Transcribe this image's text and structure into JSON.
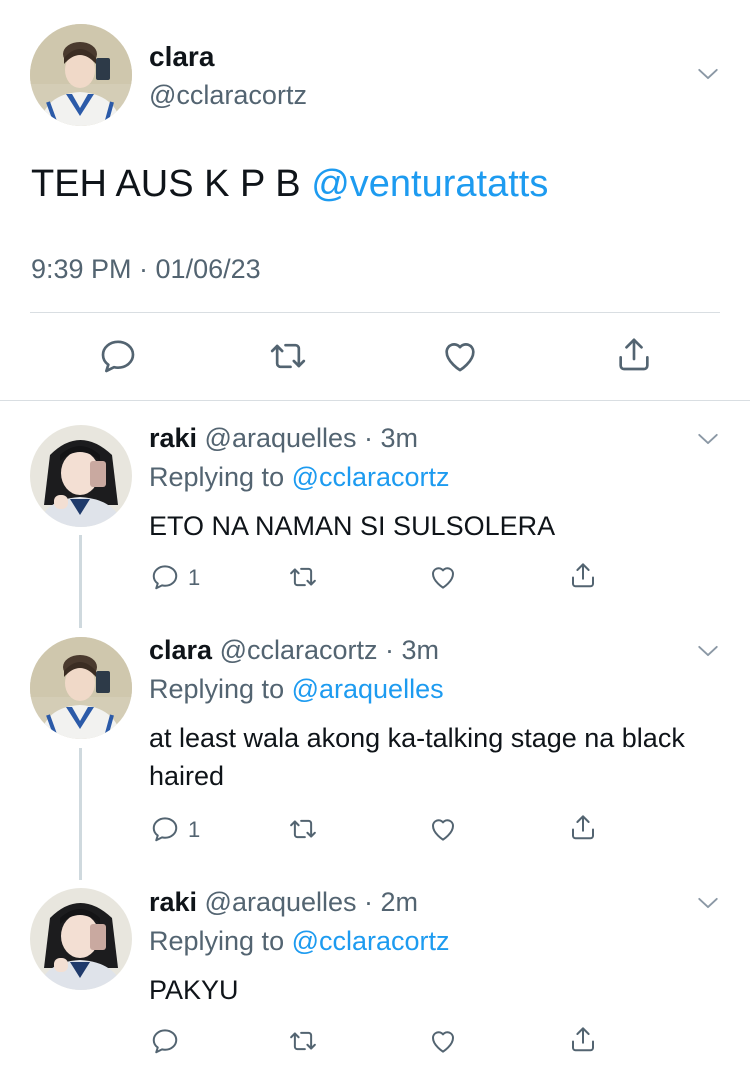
{
  "main_tweet": {
    "display_name": "clara",
    "handle": "@cclaracortz",
    "text": "TEH AUS K P B ",
    "mention": "@venturatatts",
    "timestamp": "9:39 PM · 01/06/23"
  },
  "replies": [
    {
      "display_name": "raki",
      "handle_time": " @araquelles · 3m",
      "replying_prefix": "Replying to ",
      "replying_to": "@cclaracortz",
      "text": "ETO NA NAMAN SI SULSOLERA",
      "reply_count": "1"
    },
    {
      "display_name": "clara",
      "handle_time": " @cclaracortz · 3m",
      "replying_prefix": "Replying to ",
      "replying_to": "@araquelles",
      "text": "at least wala akong ka-talking stage na black haired",
      "reply_count": "1"
    },
    {
      "display_name": "raki",
      "handle_time": " @araquelles · 2m",
      "replying_prefix": "Replying to ",
      "replying_to": "@cclaracortz",
      "text": "PAKYU",
      "reply_count": ""
    }
  ],
  "colors": {
    "accent": "#1d9bf0",
    "secondary_text": "#536471",
    "primary_text": "#0f1419",
    "divider": "#d9dee2",
    "thread_line": "#cfd9de"
  },
  "icons": [
    "chevron-down-icon",
    "reply-icon",
    "retweet-icon",
    "like-icon",
    "share-icon"
  ]
}
